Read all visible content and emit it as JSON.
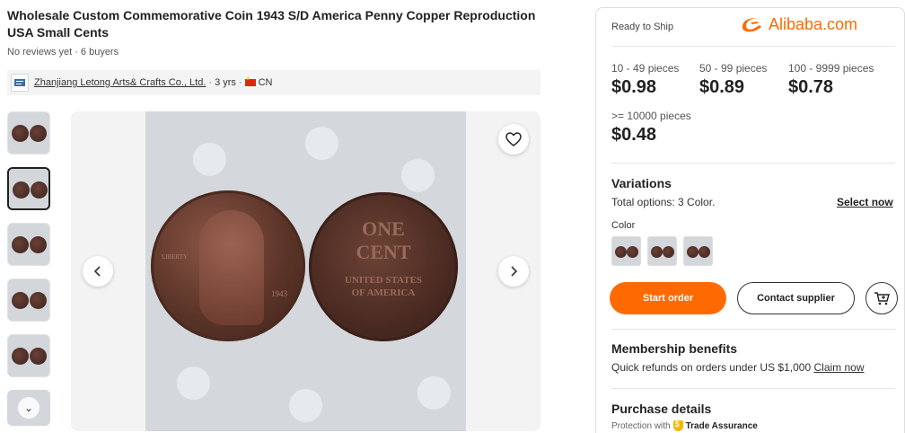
{
  "product": {
    "title": "Wholesale Custom Commemorative Coin 1943 S/D America Penny Copper Reproduction USA Small Cents",
    "reviews": "No reviews yet · 6 buyers"
  },
  "supplier": {
    "name": "Zhanjiang Letong Arts& Crafts Co., Ltd.",
    "years": "3 yrs",
    "country": "CN"
  },
  "gallery": {
    "coin_left": {
      "liberty": "LIBERTY",
      "year": "1943"
    },
    "coin_right": {
      "line1": "ONE",
      "line2": "CENT",
      "line3": "UNITED STATES",
      "line4": "OF AMERICA"
    }
  },
  "panel": {
    "ready": "Ready to Ship",
    "logo_text": "Alibaba.com",
    "tiers": [
      {
        "range": "10 - 49 pieces",
        "price": "$0.98"
      },
      {
        "range": "50 - 99 pieces",
        "price": "$0.89"
      },
      {
        "range": "100 - 9999 pieces",
        "price": "$0.78"
      },
      {
        "range": ">= 10000 pieces",
        "price": "$0.48"
      }
    ],
    "variations_title": "Variations",
    "total_options": "Total options: 3 Color.",
    "select_now": "Select now",
    "color_label": "Color",
    "start_order": "Start order",
    "contact_supplier": "Contact supplier",
    "membership_title": "Membership benefits",
    "membership_text": "Quick refunds on orders under US $1,000",
    "claim_now": "Claim now",
    "purchase_title": "Purchase details",
    "protection_text": "Protection with",
    "trade_assurance": "Trade Assurance"
  },
  "colors": {
    "accent": "#ff6a00"
  }
}
